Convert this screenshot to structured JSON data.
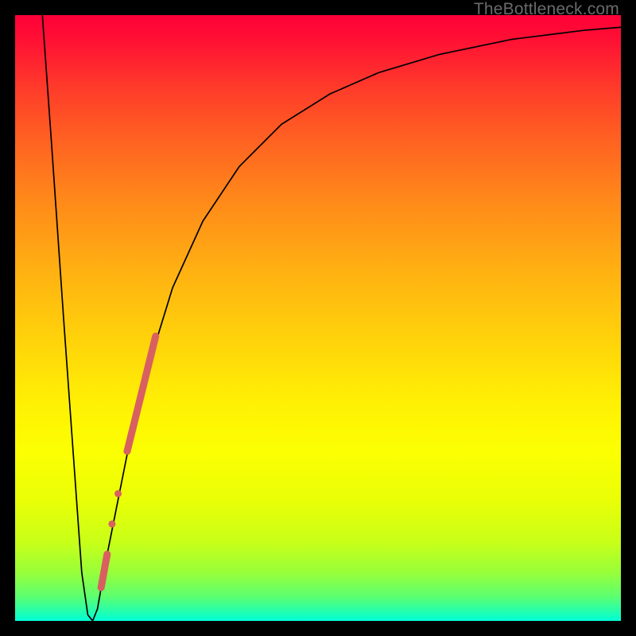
{
  "watermark": "TheBottleneck.com",
  "chart_data": {
    "type": "line",
    "title": "",
    "xlabel": "",
    "ylabel": "",
    "xlim": [
      0,
      100
    ],
    "ylim": [
      0,
      100
    ],
    "grid": false,
    "legend": false,
    "background_gradient": {
      "direction": "vertical",
      "stops": [
        {
          "pos": 0.0,
          "color": "#ff0038"
        },
        {
          "pos": 0.5,
          "color": "#ffc80e"
        },
        {
          "pos": 0.72,
          "color": "#fcff02"
        },
        {
          "pos": 1.0,
          "color": "#00ffd8"
        }
      ]
    },
    "series": [
      {
        "name": "bottleneck-curve",
        "color": "#000000",
        "stroke_width": 1.5,
        "x": [
          4.5,
          6,
          8,
          10,
          11,
          12,
          12.8,
          13.6,
          15,
          17,
          19,
          22,
          26,
          31,
          37,
          44,
          52,
          60,
          70,
          82,
          94,
          100
        ],
        "y": [
          100,
          79,
          50,
          22,
          8,
          1,
          0,
          2,
          10,
          20,
          30,
          42,
          55,
          66,
          75,
          82,
          87,
          90.5,
          93.5,
          96,
          97.5,
          98
        ]
      },
      {
        "name": "highlight-segment-upper",
        "color": "#d86060",
        "stroke_width": 9,
        "linecap": "round",
        "x": [
          18.5,
          23.2
        ],
        "y": [
          28,
          47
        ]
      },
      {
        "name": "highlight-dot-1",
        "color": "#d86060",
        "type": "scatter",
        "marker_size": 9,
        "x": [
          16.0
        ],
        "y": [
          16.0
        ]
      },
      {
        "name": "highlight-dot-2",
        "color": "#d86060",
        "type": "scatter",
        "marker_size": 9,
        "x": [
          17.0
        ],
        "y": [
          21.0
        ]
      },
      {
        "name": "highlight-segment-lower",
        "color": "#d86060",
        "stroke_width": 9,
        "linecap": "round",
        "x": [
          14.2,
          15.2
        ],
        "y": [
          5.5,
          11.0
        ]
      }
    ]
  }
}
